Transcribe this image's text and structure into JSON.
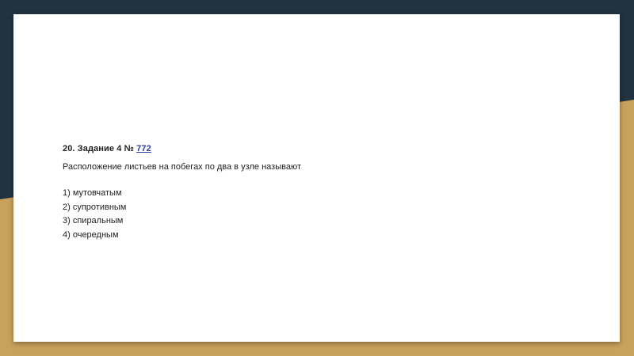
{
  "colors": {
    "background_top": "#213240",
    "background_bottom": "#c8a15c",
    "slide": "#ffffff",
    "link": "#2c3e9c"
  },
  "task": {
    "heading_prefix": "20. Задание 4 № ",
    "number_link": "772",
    "question": "Расположение листьев на побегах по два в узле называют",
    "options": [
      "1) мутовчатым",
      "2) супротивным",
      "3) спиральным",
      "4) очередным"
    ]
  }
}
